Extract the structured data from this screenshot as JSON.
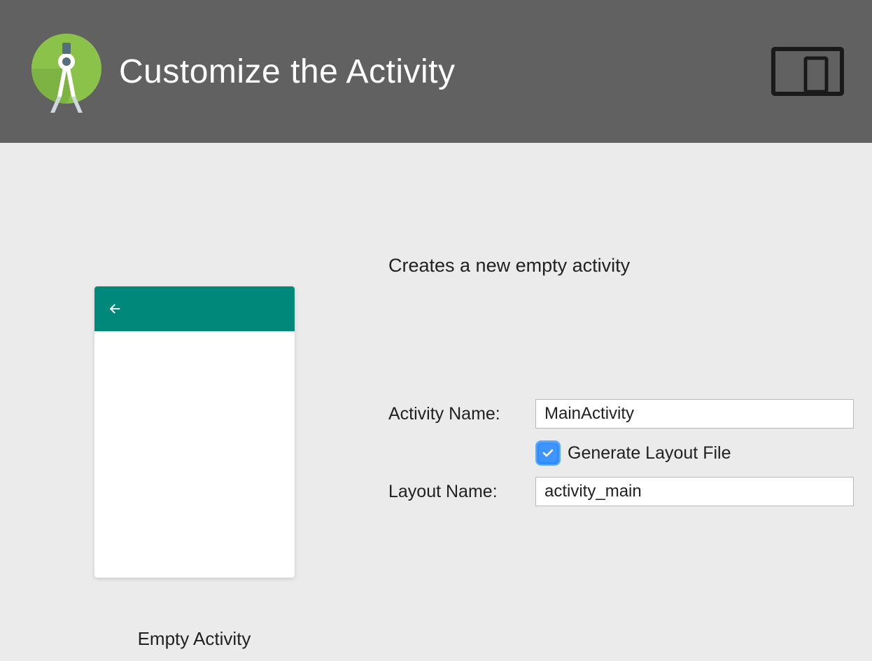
{
  "header": {
    "title": "Customize the Activity"
  },
  "description": "Creates a new empty activity",
  "preview": {
    "template_name": "Empty Activity"
  },
  "form": {
    "activity_name_label": "Activity Name:",
    "activity_name_value": "MainActivity",
    "generate_layout_label": "Generate Layout File",
    "generate_layout_checked": true,
    "layout_name_label": "Layout Name:",
    "layout_name_value": "activity_main"
  }
}
